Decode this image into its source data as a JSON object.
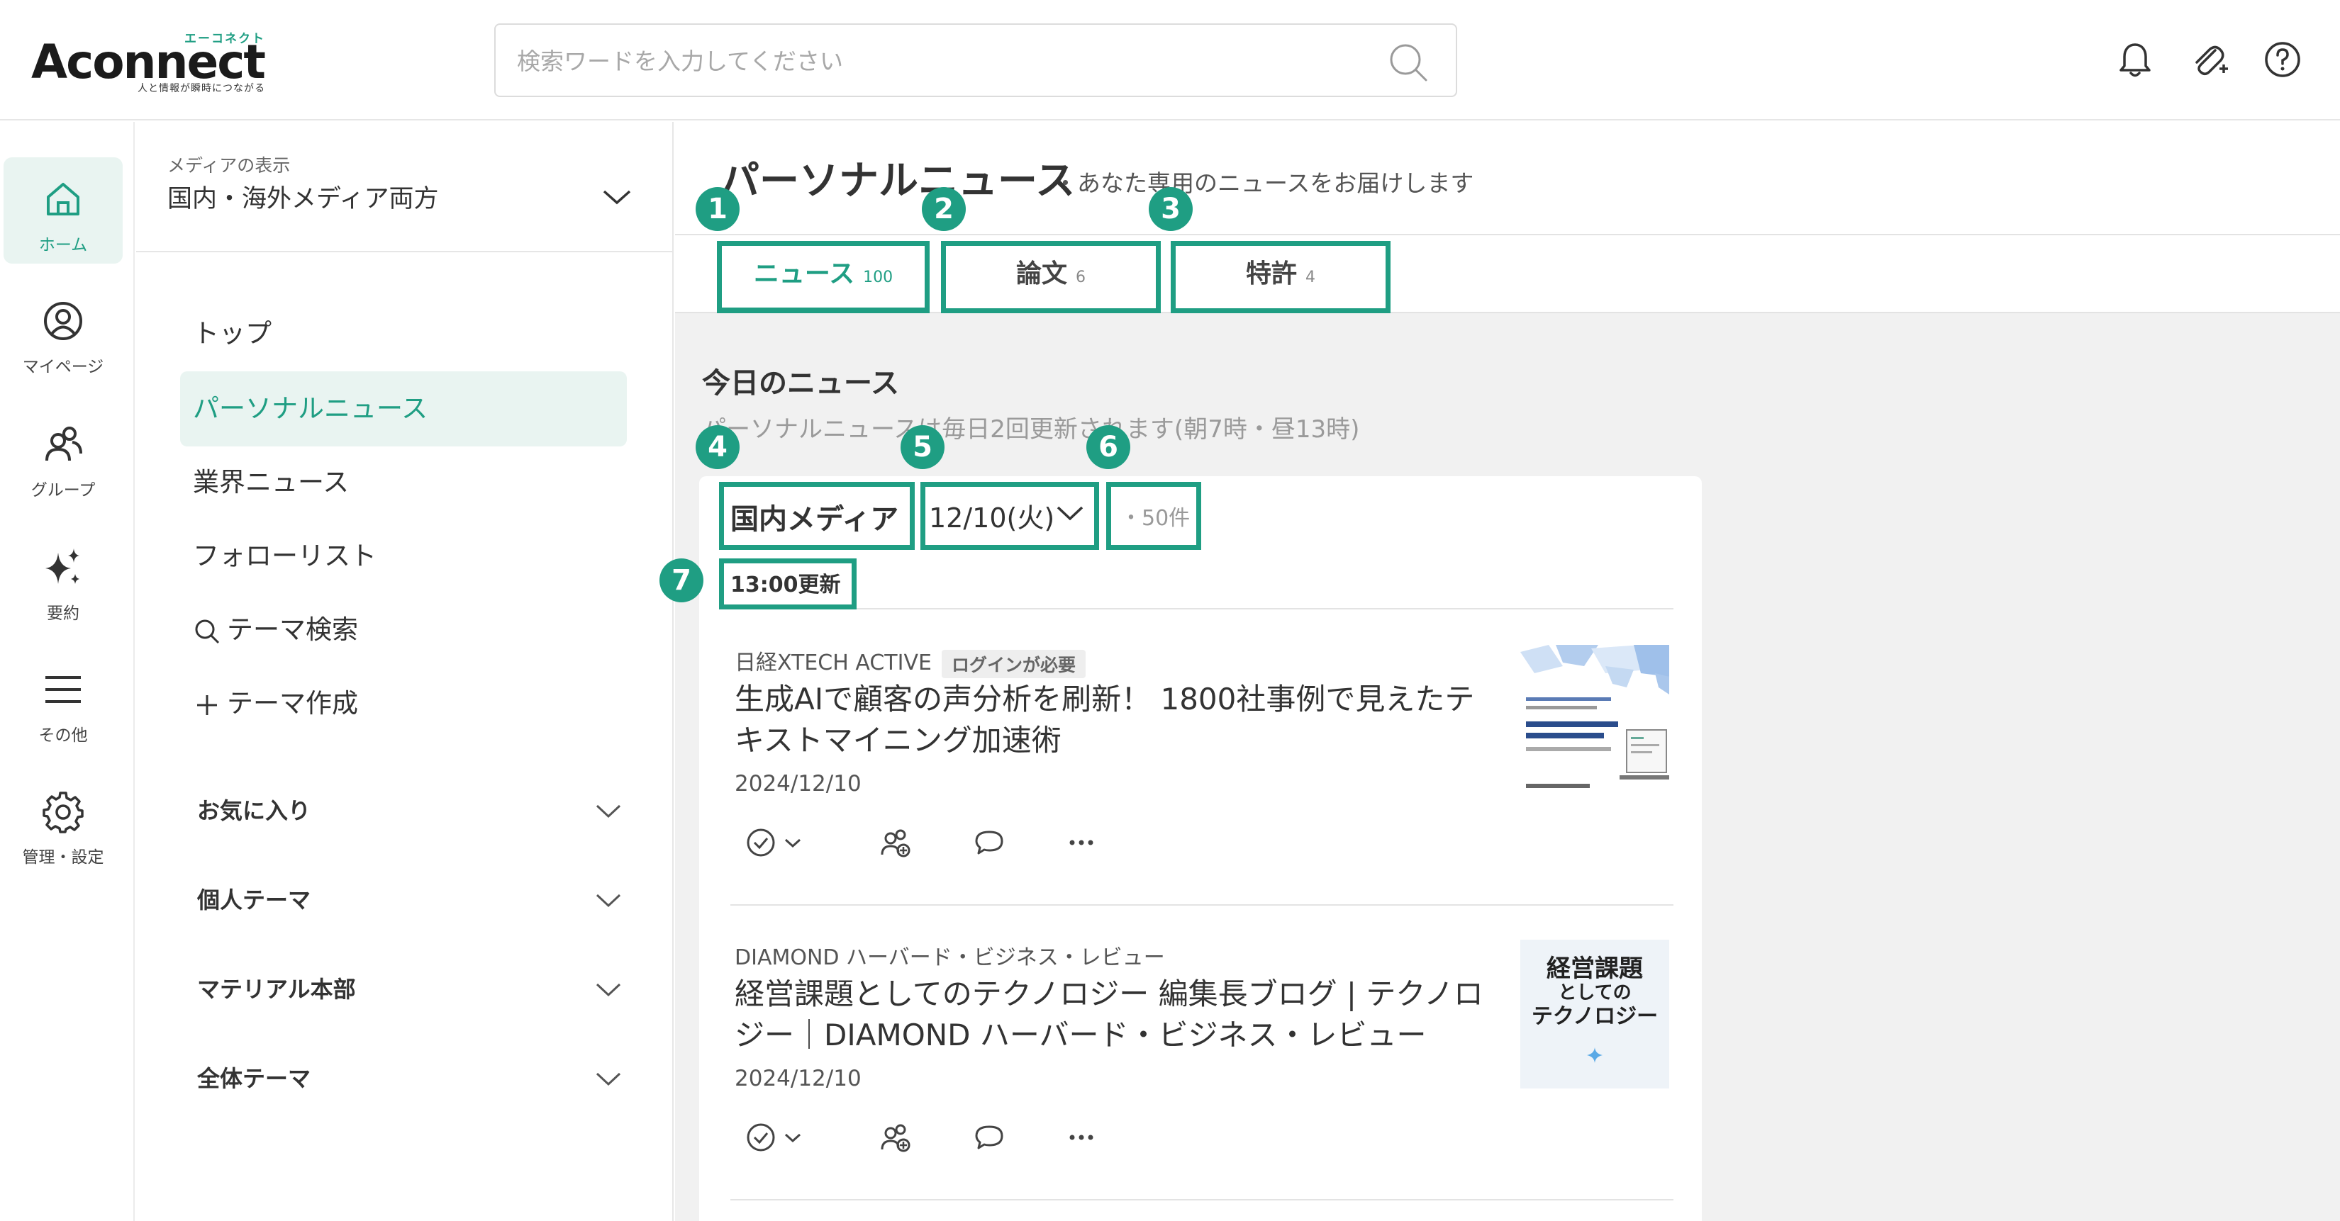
{
  "header": {
    "logo_kana": "エーコネクト",
    "logo_text": "Aconnect",
    "logo_tagline": "人と情報が瞬時につながる",
    "search_placeholder": "検索ワードを入力してください"
  },
  "rail": {
    "items": [
      {
        "label": "ホーム",
        "icon": "home-icon",
        "active": true
      },
      {
        "label": "マイページ",
        "icon": "user-circle-icon"
      },
      {
        "label": "グループ",
        "icon": "group-icon"
      },
      {
        "label": "要約",
        "icon": "sparkle-icon"
      },
      {
        "label": "その他",
        "icon": "menu-icon"
      },
      {
        "label": "管理・設定",
        "icon": "gear-icon"
      }
    ]
  },
  "sidebar": {
    "media_label": "メディアの表示",
    "media_value": "国内・海外メディア両方",
    "nav": [
      {
        "label": "トップ"
      },
      {
        "label": "パーソナルニュース",
        "active": true
      },
      {
        "label": "業界ニュース"
      },
      {
        "label": "フォローリスト"
      },
      {
        "label": "テーマ検索",
        "icon": "search-icon"
      },
      {
        "label": "テーマ作成",
        "icon": "plus-icon"
      }
    ],
    "groups": [
      {
        "label": "お気に入り"
      },
      {
        "label": "個人テーマ"
      },
      {
        "label": "マテリアル本部"
      },
      {
        "label": "全体テーマ"
      }
    ]
  },
  "main": {
    "title": "パーソナルニュース",
    "subtitle": "・あなた専用のニュースをお届けします",
    "tabs": [
      {
        "label": "ニュース",
        "count": "100",
        "active": true
      },
      {
        "label": "論文",
        "count": "6"
      },
      {
        "label": "特許",
        "count": "4"
      }
    ],
    "section_title": "今日のニュース",
    "section_sub": "パーソナルニュースは毎日2回更新されます(朝7時・昼13時)",
    "media_tab": "国内メディア",
    "date": "12/10(火)",
    "count": "・50件",
    "update": "13:00更新",
    "articles": [
      {
        "source": "日経XTECH ACTIVE",
        "badge": "ログインが必要",
        "title": "生成AIで顧客の声分析を刷新！ 1800社事例で見えたテキストマイニング加速術",
        "date": "2024/12/10"
      },
      {
        "source": "DIAMOND ハーバード・ビジネス・レビュー",
        "title": "経営課題としてのテクノロジー 編集長ブログ | テクノロジー｜DIAMOND ハーバード・ビジネス・レビュー",
        "date": "2024/12/10",
        "thumb_lines": [
          "経営課題",
          "としての",
          "テクノロジー"
        ]
      }
    ]
  },
  "annotations": [
    "1",
    "2",
    "3",
    "4",
    "5",
    "6",
    "7"
  ],
  "colors": {
    "accent": "#1f9e83",
    "active_bg": "#e9f4f1",
    "main_bg": "#f1f1f1"
  }
}
